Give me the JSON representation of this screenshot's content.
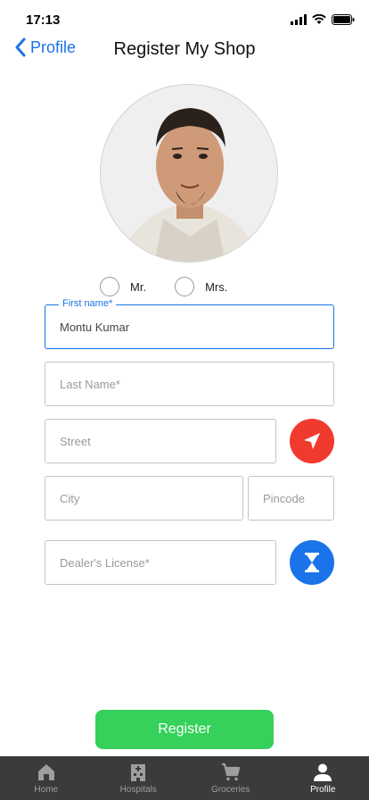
{
  "status_bar": {
    "time": "17:13"
  },
  "nav": {
    "back_label": "Profile",
    "title": "Register My Shop"
  },
  "salutation": {
    "options": [
      "Mr.",
      "Mrs."
    ]
  },
  "form": {
    "first_name": {
      "label": "First name*",
      "value": "Montu Kumar"
    },
    "last_name": {
      "placeholder": "Last Name*"
    },
    "street": {
      "placeholder": "Street"
    },
    "city": {
      "placeholder": "City"
    },
    "pincode": {
      "placeholder": "Pincode"
    },
    "dealer_license": {
      "placeholder": "Dealer's License*"
    }
  },
  "actions": {
    "register_label": "Register"
  },
  "tabs": [
    {
      "label": "Home",
      "icon": "home-icon",
      "active": false
    },
    {
      "label": "Hospitals",
      "icon": "hospital-icon",
      "active": false
    },
    {
      "label": "Groceries",
      "icon": "cart-icon",
      "active": false
    },
    {
      "label": "Profile",
      "icon": "person-icon",
      "active": true
    }
  ],
  "colors": {
    "accent": "#1a73e8",
    "location": "#f03a2e",
    "register": "#35d15a",
    "tab_bar": "#3b3b3b"
  }
}
